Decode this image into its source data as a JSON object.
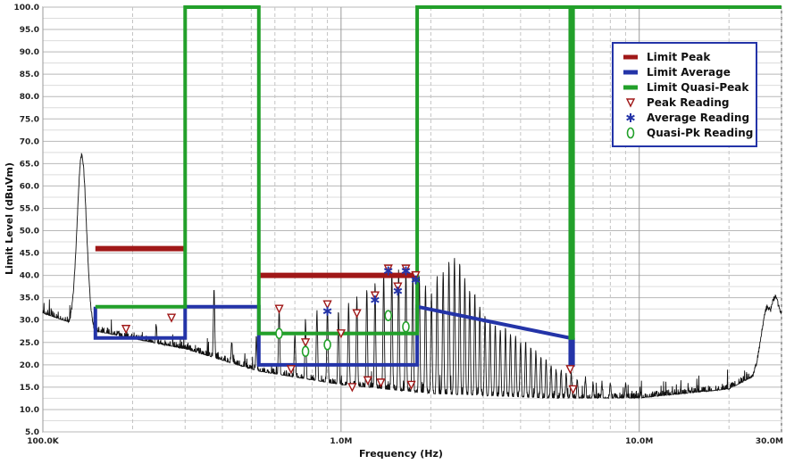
{
  "chart_data": {
    "type": "line",
    "xlabel": "Frequency (Hz)",
    "ylabel": "Limit Level (dBuVm)",
    "x_scale": "log",
    "xlim": [
      100000,
      30000000
    ],
    "ylim": [
      5,
      100
    ],
    "grid": true,
    "legend_position": "top-right",
    "x_tick_labels": [
      {
        "value": 100000,
        "label": "100.0K"
      },
      {
        "value": 1000000,
        "label": "1.0M"
      },
      {
        "value": 10000000,
        "label": "10.0M"
      },
      {
        "value": 30000000,
        "label": "30.0M"
      }
    ],
    "y_tick_labels": [
      "5.0",
      "10.0",
      "15.0",
      "20.0",
      "25.0",
      "30.0",
      "35.0",
      "40.0",
      "45.0",
      "50.0",
      "55.0",
      "60.0",
      "65.0",
      "70.0",
      "75.0",
      "80.0",
      "85.0",
      "90.0",
      "95.0",
      "100.0"
    ],
    "series": [
      {
        "name": "Limit Peak",
        "color": "#a01818",
        "segments": [
          [
            [
              150000,
              46
            ],
            [
              300000,
              46
            ]
          ],
          [
            [
              530000,
              40
            ],
            [
              1800000,
              40
            ]
          ],
          [
            [
              5870000,
              40
            ],
            [
              6000000,
              40
            ]
          ]
        ]
      },
      {
        "name": "Limit Average",
        "color": "#2434a8",
        "points": [
          [
            150000,
            33
          ],
          [
            150000,
            26
          ],
          [
            300000,
            26
          ],
          [
            300000,
            33
          ],
          [
            530000,
            33
          ],
          [
            530000,
            20
          ],
          [
            1800000,
            20
          ],
          [
            1800000,
            33
          ],
          [
            5870000,
            26
          ],
          [
            5870000,
            20
          ],
          [
            6000000,
            20
          ],
          [
            6000000,
            26
          ]
        ]
      },
      {
        "name": "Limit Quasi-Peak",
        "color": "#22a02a",
        "points": [
          [
            150000,
            33
          ],
          [
            300000,
            33
          ],
          [
            300000,
            100
          ],
          [
            530000,
            100
          ],
          [
            530000,
            27
          ],
          [
            1800000,
            27
          ],
          [
            1800000,
            100
          ],
          [
            5870000,
            100
          ],
          [
            5870000,
            26
          ],
          [
            6000000,
            26
          ],
          [
            6000000,
            100
          ],
          [
            30000000,
            100
          ]
        ]
      },
      {
        "name": "Peak Reading",
        "color": "#a01818",
        "marker": "triangle-down",
        "points": [
          [
            190000,
            28
          ],
          [
            270000,
            30.5
          ],
          [
            620000,
            32.5
          ],
          [
            680000,
            19
          ],
          [
            760000,
            25
          ],
          [
            900000,
            33.5
          ],
          [
            1000000,
            27
          ],
          [
            1090000,
            15
          ],
          [
            1130000,
            31.5
          ],
          [
            1230000,
            16.5
          ],
          [
            1300000,
            35.5
          ],
          [
            1360000,
            16
          ],
          [
            1440000,
            41.5
          ],
          [
            1550000,
            37.5
          ],
          [
            1650000,
            41.5
          ],
          [
            1720000,
            15.5
          ],
          [
            1780000,
            40
          ],
          [
            5870000,
            19
          ],
          [
            6000000,
            14.5
          ]
        ]
      },
      {
        "name": "Average Reading",
        "color": "#2434a8",
        "marker": "asterisk",
        "points": [
          [
            900000,
            32
          ],
          [
            1300000,
            34.5
          ],
          [
            1440000,
            41
          ],
          [
            1550000,
            36.5
          ],
          [
            1650000,
            41
          ],
          [
            1780000,
            39
          ]
        ]
      },
      {
        "name": "Quasi-Pk Reading",
        "color": "#22a02a",
        "marker": "ellipse",
        "points": [
          [
            620000,
            27
          ],
          [
            760000,
            23
          ],
          [
            900000,
            24.5
          ],
          [
            1440000,
            31
          ],
          [
            1650000,
            28.5
          ]
        ]
      },
      {
        "name": "",
        "color": "#111111",
        "style": "noise-trace",
        "floor_profile": [
          [
            100000,
            31
          ],
          [
            150000,
            27
          ],
          [
            300000,
            23
          ],
          [
            530000,
            18
          ],
          [
            1000000,
            15
          ],
          [
            2000000,
            13
          ],
          [
            5000000,
            12
          ],
          [
            10000000,
            12
          ],
          [
            20000000,
            14
          ],
          [
            26000000,
            18
          ],
          [
            30000000,
            25
          ]
        ],
        "peaks": [
          [
            135000,
            67
          ],
          [
            175000,
            25
          ],
          [
            240000,
            29
          ],
          [
            375000,
            37
          ],
          [
            430000,
            25
          ],
          [
            520000,
            26
          ],
          [
            620000,
            32
          ],
          [
            700000,
            27
          ],
          [
            760000,
            30
          ],
          [
            830000,
            32
          ],
          [
            900000,
            33
          ],
          [
            980000,
            32
          ],
          [
            1060000,
            34
          ],
          [
            1130000,
            35
          ],
          [
            1220000,
            37
          ],
          [
            1300000,
            38
          ],
          [
            1390000,
            40
          ],
          [
            1480000,
            41
          ],
          [
            1560000,
            41
          ],
          [
            1650000,
            41
          ],
          [
            1740000,
            41
          ],
          [
            1830000,
            40
          ],
          [
            1920000,
            38
          ],
          [
            2010000,
            36
          ],
          [
            2100000,
            40
          ],
          [
            2200000,
            41
          ],
          [
            2300000,
            43
          ],
          [
            2400000,
            44
          ],
          [
            2500000,
            43
          ],
          [
            2600000,
            40
          ],
          [
            2700000,
            37
          ],
          [
            2810000,
            36
          ],
          [
            2920000,
            33
          ],
          [
            3040000,
            31
          ],
          [
            3160000,
            30
          ],
          [
            3290000,
            29
          ],
          [
            3420000,
            28
          ],
          [
            3560000,
            28
          ],
          [
            3700000,
            27
          ],
          [
            3850000,
            27
          ],
          [
            4000000,
            25
          ],
          [
            4160000,
            25
          ],
          [
            4330000,
            24
          ],
          [
            4500000,
            23
          ],
          [
            4680000,
            22
          ],
          [
            4870000,
            21
          ],
          [
            5060000,
            20
          ],
          [
            5260000,
            19
          ],
          [
            5470000,
            19
          ],
          [
            5690000,
            18
          ],
          [
            5920000,
            18
          ],
          [
            6200000,
            17
          ],
          [
            6600000,
            17
          ],
          [
            7000000,
            16
          ],
          [
            7500000,
            16
          ],
          [
            8000000,
            16
          ],
          [
            9000000,
            16
          ],
          [
            27000000,
            33
          ],
          [
            28500000,
            35
          ],
          [
            29500000,
            32
          ]
        ]
      }
    ]
  }
}
